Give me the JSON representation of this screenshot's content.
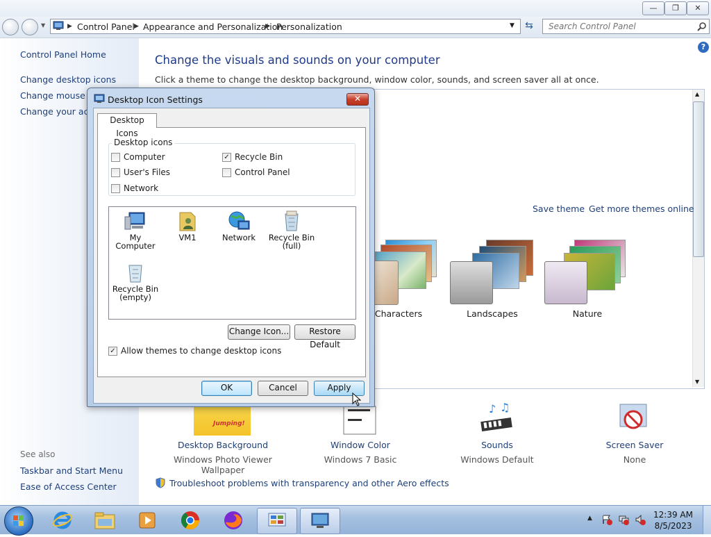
{
  "window": {
    "minimize": "—",
    "maximize": "❐",
    "close": "✕"
  },
  "address": {
    "crumbs": [
      "Control Panel",
      "Appearance and Personalization",
      "Personalization"
    ],
    "search_placeholder": "Search Control Panel"
  },
  "left_pane": {
    "home": "Control Panel Home",
    "links": [
      "Change desktop icons",
      "Change mouse pointers",
      "Change your account picture"
    ],
    "see_also": "See also",
    "see_also_links": [
      "Taskbar and Start Menu",
      "Ease of Access Center"
    ]
  },
  "main": {
    "title": "Change the visuals and sounds on your computer",
    "description": "Click a theme to change the desktop background, window color, sounds, and screen saver all at once.",
    "save_theme": "Save theme",
    "get_more": "Get more themes online",
    "themes": [
      "Characters",
      "Landscapes",
      "Nature"
    ],
    "bottom": [
      {
        "label": "Desktop Background",
        "sub": "Windows Photo Viewer Wallpaper"
      },
      {
        "label": "Window Color",
        "sub": "Windows 7 Basic"
      },
      {
        "label": "Sounds",
        "sub": "Windows Default"
      },
      {
        "label": "Screen Saver",
        "sub": "None"
      }
    ],
    "troubleshoot": "Troubleshoot problems with transparency and other Aero effects",
    "jumping_text": "Jumping!"
  },
  "dialog": {
    "title": "Desktop Icon Settings",
    "tab": "Desktop Icons",
    "group_title": "Desktop icons",
    "checkboxes": [
      {
        "label": "Computer",
        "checked": false
      },
      {
        "label": "User's Files",
        "checked": false
      },
      {
        "label": "Network",
        "checked": false
      },
      {
        "label": "Recycle Bin",
        "checked": true
      },
      {
        "label": "Control Panel",
        "checked": false
      }
    ],
    "icons": [
      {
        "line1": "My Computer",
        "line2": ""
      },
      {
        "line1": "VM1",
        "line2": ""
      },
      {
        "line1": "Network",
        "line2": ""
      },
      {
        "line1": "Recycle Bin",
        "line2": "(full)"
      },
      {
        "line1": "Recycle Bin",
        "line2": "(empty)"
      }
    ],
    "change_icon": "Change Icon...",
    "restore_default": "Restore Default",
    "allow_themes": "Allow themes to change desktop icons",
    "allow_themes_checked": true,
    "ok": "OK",
    "cancel": "Cancel",
    "apply": "Apply"
  },
  "taskbar": {
    "time": "12:39 AM",
    "date": "8/5/2023"
  },
  "colors": {
    "link": "#1e3f78",
    "title": "#1e3a8a"
  }
}
